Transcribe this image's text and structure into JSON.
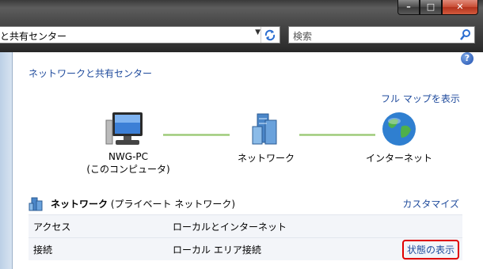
{
  "window": {
    "minimize_glyph": "–",
    "maximize_glyph": "□",
    "close_glyph": "✕"
  },
  "address_bar": {
    "text": "と共有センター",
    "dropdown_glyph": "▼"
  },
  "search": {
    "placeholder": "検索"
  },
  "page": {
    "title": "ネットワークと共有センター",
    "full_map_link": "フル マップを表示",
    "help_glyph": "?"
  },
  "map": {
    "nodes": [
      {
        "line1": "NWG-PC",
        "line2": "(このコンピュータ)",
        "icon": "computer-icon"
      },
      {
        "line1": "ネットワーク",
        "line2": "",
        "icon": "network-icon"
      },
      {
        "line1": "インターネット",
        "line2": "",
        "icon": "globe-icon"
      }
    ]
  },
  "network_section": {
    "name": "ネットワーク",
    "type": " (プライベート ネットワーク)",
    "customize_link": "カスタマイズ",
    "rows": [
      {
        "label": "アクセス",
        "value": "ローカルとインターネット",
        "link": ""
      },
      {
        "label": "接続",
        "value": "ローカル エリア接続",
        "link": "状態の表示"
      }
    ]
  },
  "colors": {
    "link": "#1e4a9c",
    "highlight": "#e00000",
    "connector": "#8fc26a"
  }
}
